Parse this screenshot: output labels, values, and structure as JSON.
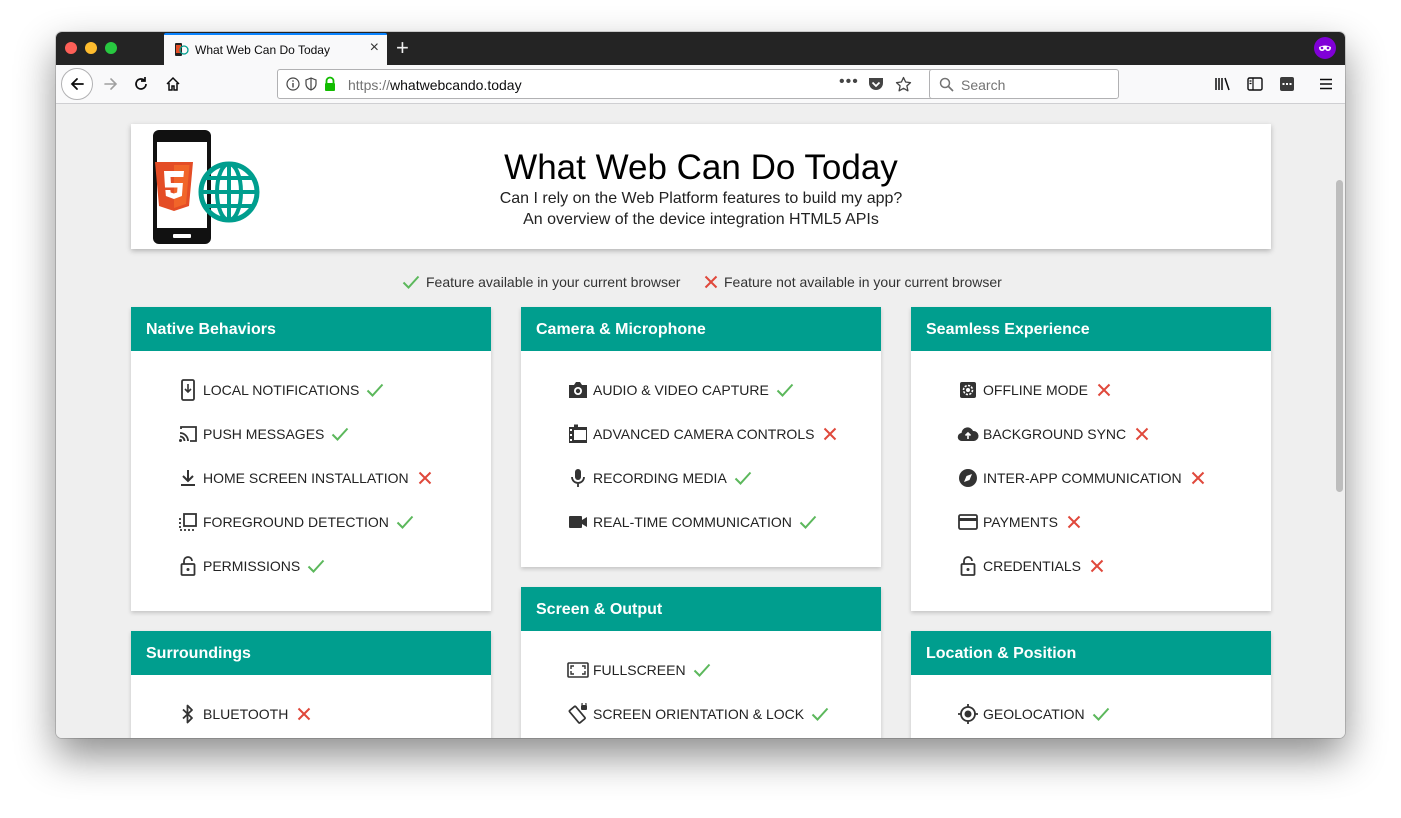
{
  "browser": {
    "tab_title": "What Web Can Do Today",
    "url_protocol": "https://",
    "url_host": "whatwebcando.today",
    "search_placeholder": "Search"
  },
  "header": {
    "title": "What Web Can Do Today",
    "subtitle1": "Can I rely on the Web Platform features to build my app?",
    "subtitle2": "An overview of the device integration HTML5 APIs"
  },
  "legend": {
    "available": "Feature available in your current browser",
    "not_available": "Feature not available in your current browser"
  },
  "colors": {
    "accent": "#009e8e",
    "check": "#5cb85c",
    "cross": "#e0483b"
  },
  "sections": [
    {
      "title": "Native Behaviors",
      "features": [
        {
          "label": "LOCAL NOTIFICATIONS",
          "icon": "phone-notification-icon",
          "available": true
        },
        {
          "label": "PUSH MESSAGES",
          "icon": "cast-icon",
          "available": true
        },
        {
          "label": "HOME SCREEN INSTALLATION",
          "icon": "download-icon",
          "available": false
        },
        {
          "label": "FOREGROUND DETECTION",
          "icon": "select-window-icon",
          "available": true
        },
        {
          "label": "PERMISSIONS",
          "icon": "lock-icon",
          "available": true
        }
      ]
    },
    {
      "title": "Camera & Microphone",
      "features": [
        {
          "label": "AUDIO & VIDEO CAPTURE",
          "icon": "camera-icon",
          "available": true
        },
        {
          "label": "ADVANCED CAMERA CONTROLS",
          "icon": "film-icon",
          "available": false
        },
        {
          "label": "RECORDING MEDIA",
          "icon": "microphone-icon",
          "available": true
        },
        {
          "label": "REAL-TIME COMMUNICATION",
          "icon": "video-camera-icon",
          "available": true
        }
      ]
    },
    {
      "title": "Seamless Experience",
      "features": [
        {
          "label": "OFFLINE MODE",
          "icon": "gear-icon",
          "available": false
        },
        {
          "label": "BACKGROUND SYNC",
          "icon": "cloud-upload-icon",
          "available": false
        },
        {
          "label": "INTER-APP COMMUNICATION",
          "icon": "compass-icon",
          "available": false
        },
        {
          "label": "PAYMENTS",
          "icon": "credit-card-icon",
          "available": false
        },
        {
          "label": "CREDENTIALS",
          "icon": "lock-icon",
          "available": false
        }
      ]
    },
    {
      "title": "Surroundings",
      "features": [
        {
          "label": "BLUETOOTH",
          "icon": "bluetooth-icon",
          "available": false
        }
      ]
    },
    {
      "title": "Screen & Output",
      "features": [
        {
          "label": "FULLSCREEN",
          "icon": "fullscreen-icon",
          "available": true
        },
        {
          "label": "SCREEN ORIENTATION & LOCK",
          "icon": "screen-rotation-icon",
          "available": true
        }
      ]
    },
    {
      "title": "Location & Position",
      "features": [
        {
          "label": "GEOLOCATION",
          "icon": "crosshair-icon",
          "available": true
        }
      ]
    }
  ]
}
